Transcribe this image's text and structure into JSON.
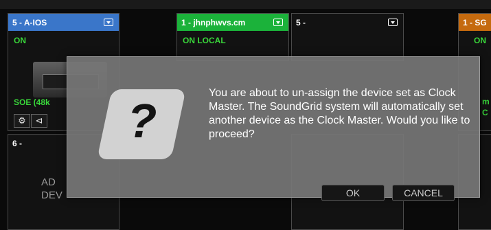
{
  "colors": {
    "slot_blue": "#3a76c9",
    "slot_green": "#1bb23a",
    "slot_orange": "#c56a0e",
    "status_green": "#39d73a",
    "dialog_gray": "#767676"
  },
  "slots": {
    "a": {
      "title": "5 - A-IOS",
      "status": "ON",
      "rate": "SOE (48k"
    },
    "b": {
      "title": "1 - jhnphwvs.cm",
      "status": "ON  LOCAL"
    },
    "c": {
      "title": "5 -"
    },
    "d": {
      "title": "1 - SG",
      "status": "ON",
      "edge_text": "m\nC"
    },
    "e": {
      "title": "6 -",
      "add_label": "AD\nDEV"
    }
  },
  "slot_icons": [
    "gear-icon",
    "share-icon"
  ],
  "dialog": {
    "message": "You are about to un-assign the device set as Clock Master. The SoundGrid system will automatically set another device as the Clock Master. Would you like to proceed?",
    "icon_glyph": "?",
    "ok_label": "OK",
    "cancel_label": "CANCEL"
  }
}
